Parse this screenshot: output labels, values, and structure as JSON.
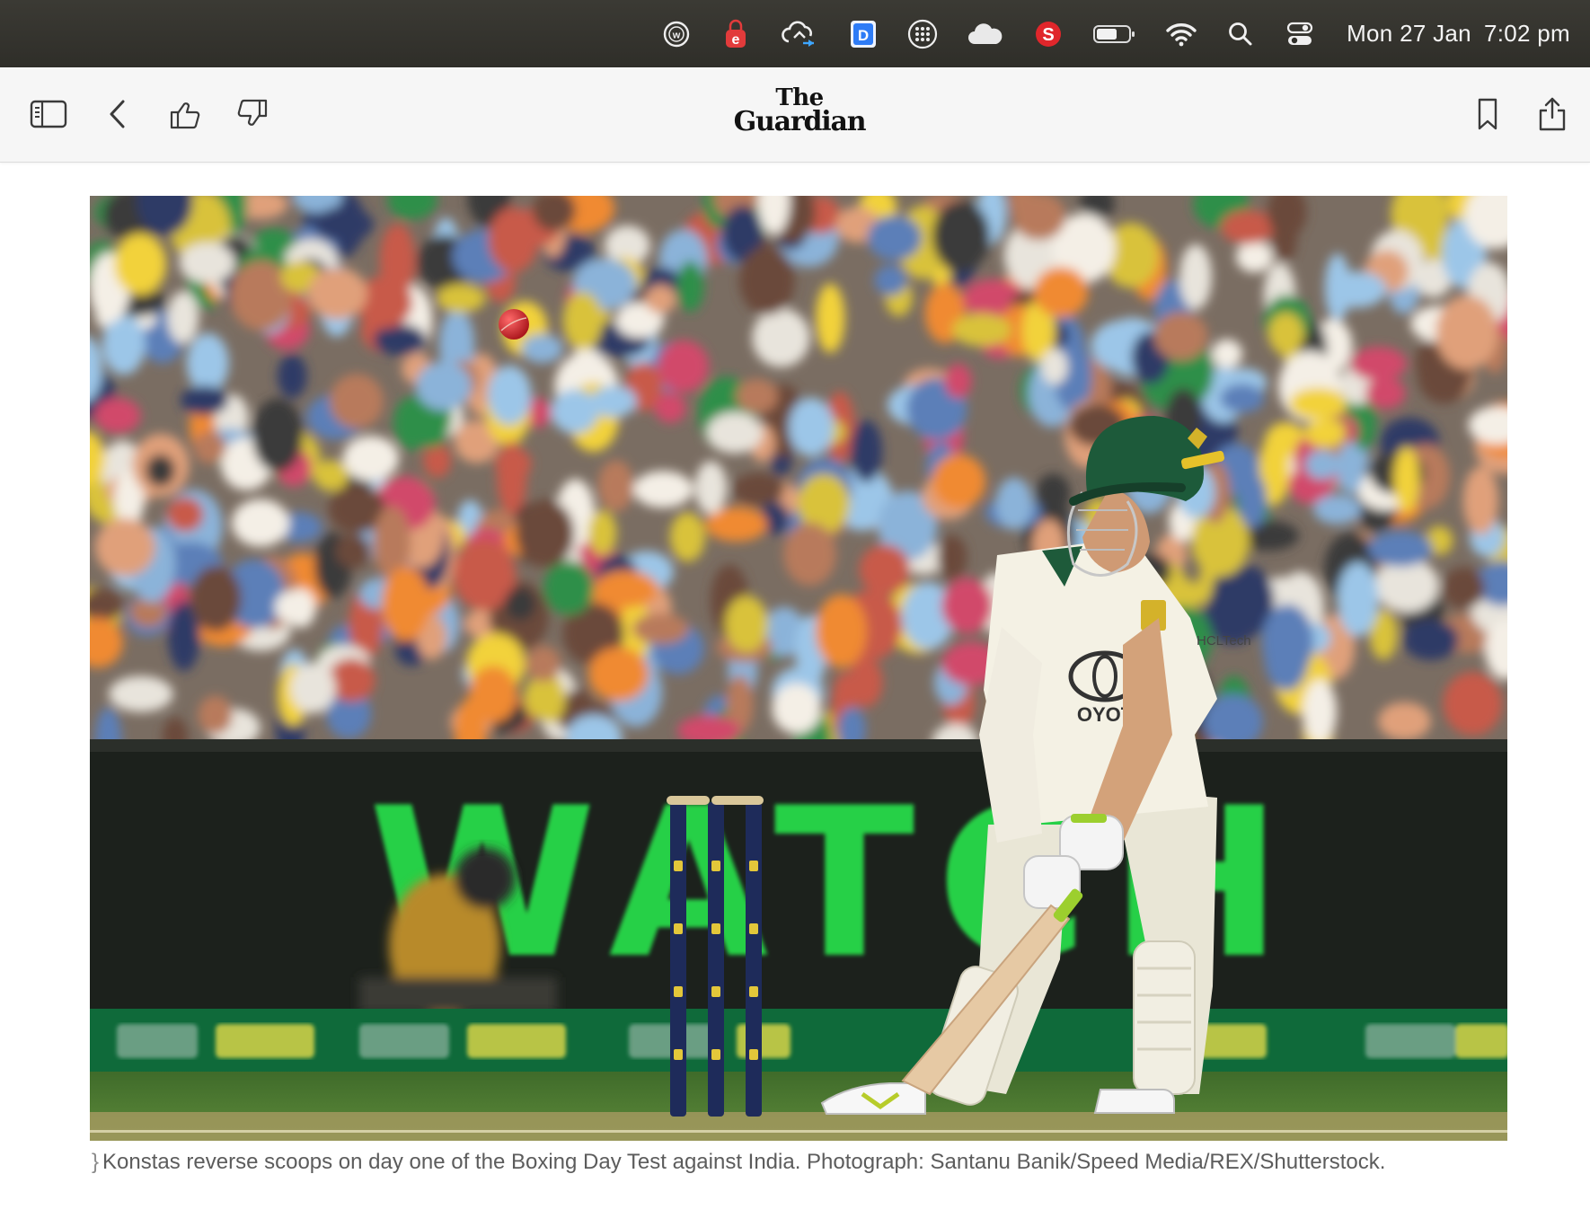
{
  "menubar": {
    "icons": [
      "w-circle-icon",
      "e-lock-icon",
      "cloud-sync-icon",
      "d-app-icon",
      "launchpad-dots-icon",
      "icloud-icon",
      "s-app-icon",
      "battery-icon",
      "wifi-icon",
      "search-icon",
      "control-center-icon"
    ],
    "date": "Mon 27 Jan",
    "time": "7:02 pm"
  },
  "toolbar": {
    "logo_line1": "The",
    "logo_line2": "Guardian"
  },
  "photo": {
    "banner_text": "WATCH",
    "accent": "#2fd94a"
  },
  "caption": {
    "marker": "⁠}",
    "text": "Konstas reverse scoops on day one of the Boxing Day Test against India. Photograph: Santanu Banik/Speed Media/REX/Shutterstock."
  }
}
